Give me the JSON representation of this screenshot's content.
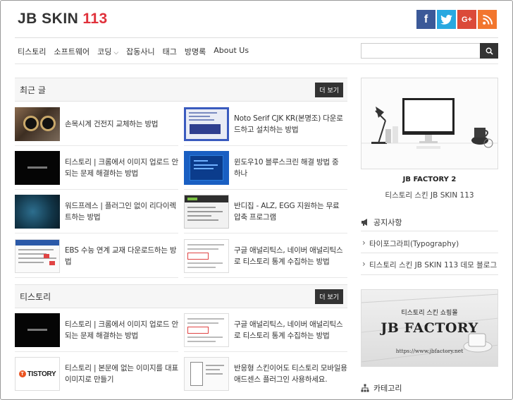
{
  "header": {
    "logo_text": "JB SKIN",
    "logo_number": "113",
    "social": {
      "facebook": "f",
      "google_plus": "G+"
    }
  },
  "nav": {
    "items": [
      "티스토리",
      "소프트웨어",
      "코딩",
      "잡동사니",
      "태그",
      "방명록",
      "About Us"
    ]
  },
  "search": {
    "placeholder": ""
  },
  "recent": {
    "title": "최근 글",
    "more": "더 보기",
    "posts": [
      {
        "title": "손목시계 건전지 교체하는 방법"
      },
      {
        "title": "Noto Serif CJK KR(본명조) 다운로드하고 설치하는 방법"
      },
      {
        "title": "티스토리 | 크롬에서 이미지 업로드 안되는 문제 해결하는 방법"
      },
      {
        "title": "윈도우10 블루스크린 해결 방법 중 하나"
      },
      {
        "title": "워드프레스 | 플러그인 없이 리다이렉트하는 방법"
      },
      {
        "title": "반디집 - ALZ, EGG 지원하는 무료 압축 프로그램"
      },
      {
        "title": "EBS 수능 연계 교재 다운로드하는 방법"
      },
      {
        "title": "구글 애널리틱스, 네이버 애널리틱스로 티스토리 통계 수집하는 방법"
      }
    ]
  },
  "tistory": {
    "title": "티스토리",
    "more": "더 보기",
    "posts": [
      {
        "title": "티스토리 | 크롬에서 이미지 업로드 안되는 문제 해결하는 방법"
      },
      {
        "title": "구글 애널리틱스, 네이버 애널리틱스로 티스토리 통계 수집하는 방법"
      },
      {
        "title": "티스토리 | 본문에 없는 이미지를 대표이미지로 만들기",
        "thumb_text": "TISTORY",
        "thumb_letter": "T"
      },
      {
        "title": "반응형 스킨이어도 티스토리 모바일용 애드센스 플러그인 사용하세요."
      }
    ]
  },
  "sidebar": {
    "featured_title": "JB FACTORY 2",
    "featured_sub": "티스토리 스킨 JB SKIN 113",
    "notice_title": "공지사항",
    "notices": [
      "타이포그라피(Typography)",
      "티스토리 스킨 JB SKIN 113 데모 블로그"
    ],
    "ad": {
      "top": "티스토리 스킨 쇼핑몰",
      "brand": "JB FACTORY",
      "url": "https://www.jbfactory.net"
    },
    "category_title": "카테고리"
  }
}
